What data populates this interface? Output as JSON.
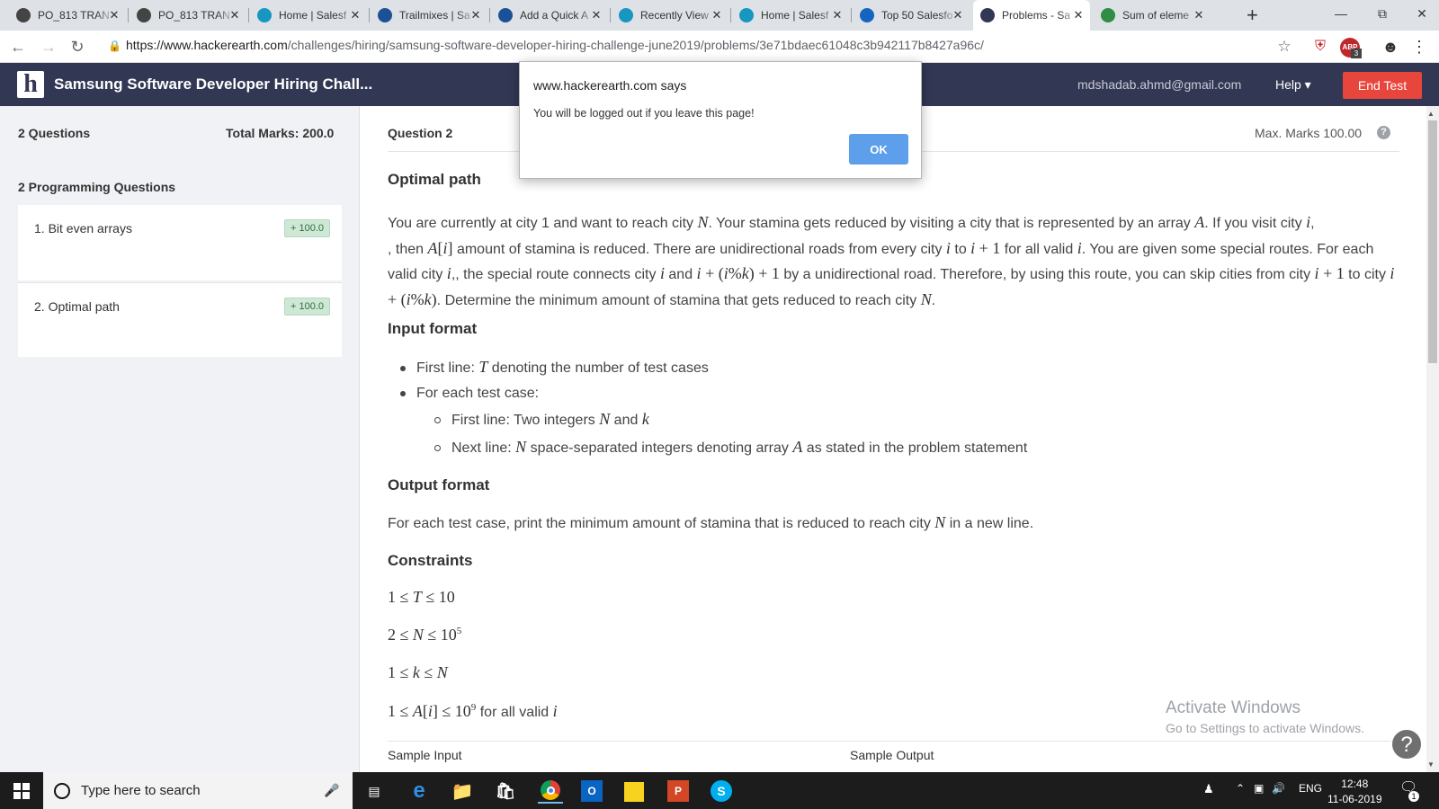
{
  "browser": {
    "tabs": [
      {
        "title": "PO_813 TRAN",
        "icon": "github-icon",
        "color": "#444"
      },
      {
        "title": "PO_813 TRAN",
        "icon": "github-icon",
        "color": "#444"
      },
      {
        "title": "Home | Salesf",
        "icon": "salesforce-cloud-icon",
        "color": "#1797c0"
      },
      {
        "title": "Trailmixes | Sa",
        "icon": "trailhead-icon",
        "color": "#1b5297"
      },
      {
        "title": "Add a Quick A",
        "icon": "trailhead-icon",
        "color": "#1b5297"
      },
      {
        "title": "Recently View",
        "icon": "salesforce-cloud-icon",
        "color": "#1797c0"
      },
      {
        "title": "Home | Salesf",
        "icon": "salesforce-cloud-icon",
        "color": "#1797c0"
      },
      {
        "title": "Top 50 Salesfo",
        "icon": "edureka-icon",
        "color": "#1565c0"
      },
      {
        "title": "Problems - Sa",
        "icon": "hackerearth-icon",
        "color": "#323754"
      },
      {
        "title": "Sum of eleme",
        "icon": "geeksforgeeks-icon",
        "color": "#2f8d46"
      }
    ],
    "active_tab_index": 8,
    "new_tab_symbol": "+",
    "url_host": "https://www.hackerearth.com",
    "url_path": "/challenges/hiring/samsung-software-developer-hiring-challenge-june2019/problems/3e71bdaec61048c3b942117b8427a96c/",
    "abp_badge": "3"
  },
  "header": {
    "logo_letter": "h",
    "title": "Samsung Software Developer Hiring Chall...",
    "email": "mdshadab.ahmd@gmail.com",
    "help": "Help ▾",
    "end_test": "End Test",
    "accent": "#323754",
    "end_test_color": "#e8453c"
  },
  "sidebar": {
    "questions_count": "2 Questions",
    "total_marks": "Total Marks: 200.0",
    "section_title": "2 Programming Questions",
    "questions": [
      {
        "title": "1. Bit even arrays",
        "marks": "+ 100.0"
      },
      {
        "title": "2. Optimal path",
        "marks": "+ 100.0"
      }
    ]
  },
  "problem": {
    "question_label": "Question  2",
    "max_marks": "Max. Marks 100.00",
    "info_symbol": "?",
    "title": "Optimal path",
    "input_heading": "Input format",
    "output_heading": "Output format",
    "constraints_heading": "Constraints",
    "sample_input": "Sample Input",
    "sample_output": "Sample Output",
    "statement": {
      "s1": "You are currently at city 1 and want to reach city ",
      "s2": ". Your stamina gets reduced by visiting a city that is represented by an array ",
      "s3": ". If you visit city ",
      "s4": ", then ",
      "s5": " amount of stamina is reduced. There are unidirectional roads from every city ",
      "s6": " to ",
      "s7": " for all valid ",
      "s8": ". You are given some special routes. For each valid city ",
      "s9": ", the special route connects city ",
      "s10": " and ",
      "s11": " by a unidirectional road. Therefore, by using this route, you can skip cities from city ",
      "s12": " to city ",
      "s13": ". Determine the minimum amount of stamina that gets reduced to reach city ",
      "s14": "."
    },
    "input_items": {
      "line1a": "First line: ",
      "line1b": " denoting the number of test cases",
      "line2": "For each test case:",
      "sub1a": "First line: Two integers ",
      "sub1b": " and ",
      "sub2a": "Next line: ",
      "sub2b": " space-separated integers denoting array ",
      "sub2c": " as stated in the problem statement"
    },
    "output_text_a": "For each test case, print the minimum amount of stamina that is reduced to reach city ",
    "output_text_b": " in a new line.",
    "constraint_suffix": " for all valid "
  },
  "dialog": {
    "title": "www.hackerearth.com says",
    "message": "You will be logged out if you leave this page!",
    "ok": "OK"
  },
  "watermark": {
    "line1": "Activate Windows",
    "line2": "Go to Settings to activate Windows."
  },
  "taskbar": {
    "search_placeholder": "Type here to search",
    "language": "ENG",
    "time": "12:48",
    "date": "11-06-2019",
    "notification_count": "1"
  }
}
